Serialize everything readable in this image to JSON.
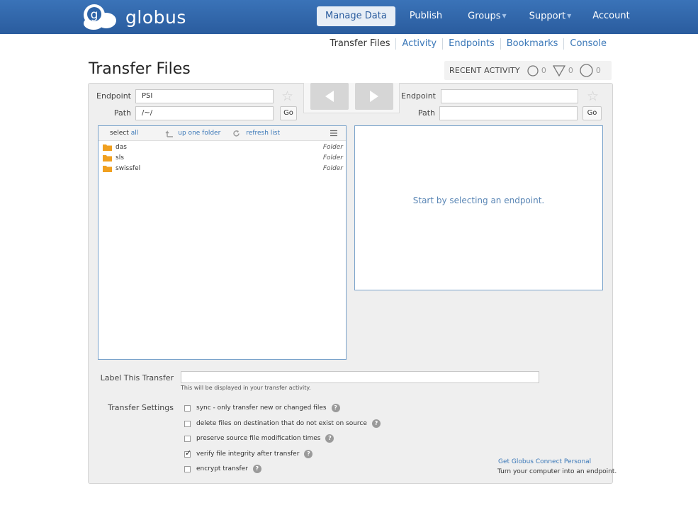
{
  "header": {
    "brand": "globus",
    "nav": [
      {
        "label": "Manage Data",
        "active": true,
        "dropdown": false
      },
      {
        "label": "Publish",
        "active": false,
        "dropdown": false
      },
      {
        "label": "Groups",
        "active": false,
        "dropdown": true
      },
      {
        "label": "Support",
        "active": false,
        "dropdown": true
      },
      {
        "label": "Account",
        "active": false,
        "dropdown": false
      }
    ]
  },
  "subnav": [
    "Transfer Files",
    "Activity",
    "Endpoints",
    "Bookmarks",
    "Console"
  ],
  "page_title": "Transfer Files",
  "recent_activity": {
    "label": "RECENT ACTIVITY",
    "in_progress": "0",
    "failed": "0",
    "succeeded": "0"
  },
  "left": {
    "endpoint_label": "Endpoint",
    "endpoint_value": "PSI",
    "path_label": "Path",
    "path_value": "/~/",
    "go_label": "Go",
    "toolbar": {
      "select": "select",
      "all": "all",
      "up": "up one folder",
      "refresh": "refresh list"
    },
    "files": [
      {
        "name": "das",
        "type": "Folder"
      },
      {
        "name": "sls",
        "type": "Folder"
      },
      {
        "name": "swissfel",
        "type": "Folder"
      }
    ]
  },
  "right": {
    "endpoint_label": "Endpoint",
    "endpoint_value": "",
    "path_label": "Path",
    "path_value": "",
    "go_label": "Go",
    "empty_message": "Start by selecting an endpoint."
  },
  "transfer_label": {
    "title": "Label This Transfer",
    "value": "",
    "hint": "This will be displayed in your transfer activity."
  },
  "settings": {
    "title": "Transfer Settings",
    "options": [
      {
        "label": "sync - only transfer new or changed files",
        "checked": false
      },
      {
        "label": "delete files on destination that do not exist on source",
        "checked": false
      },
      {
        "label": "preserve source file modification times",
        "checked": false
      },
      {
        "label": "verify file integrity after transfer",
        "checked": true
      },
      {
        "label": "encrypt transfer",
        "checked": false
      }
    ]
  },
  "gcp": {
    "link": "Get Globus Connect Personal",
    "text": "Turn your computer into an endpoint."
  },
  "colors": {
    "header_blue": "#2e64a8",
    "link_blue": "#3b78b8",
    "folder_orange": "#f0a020"
  }
}
